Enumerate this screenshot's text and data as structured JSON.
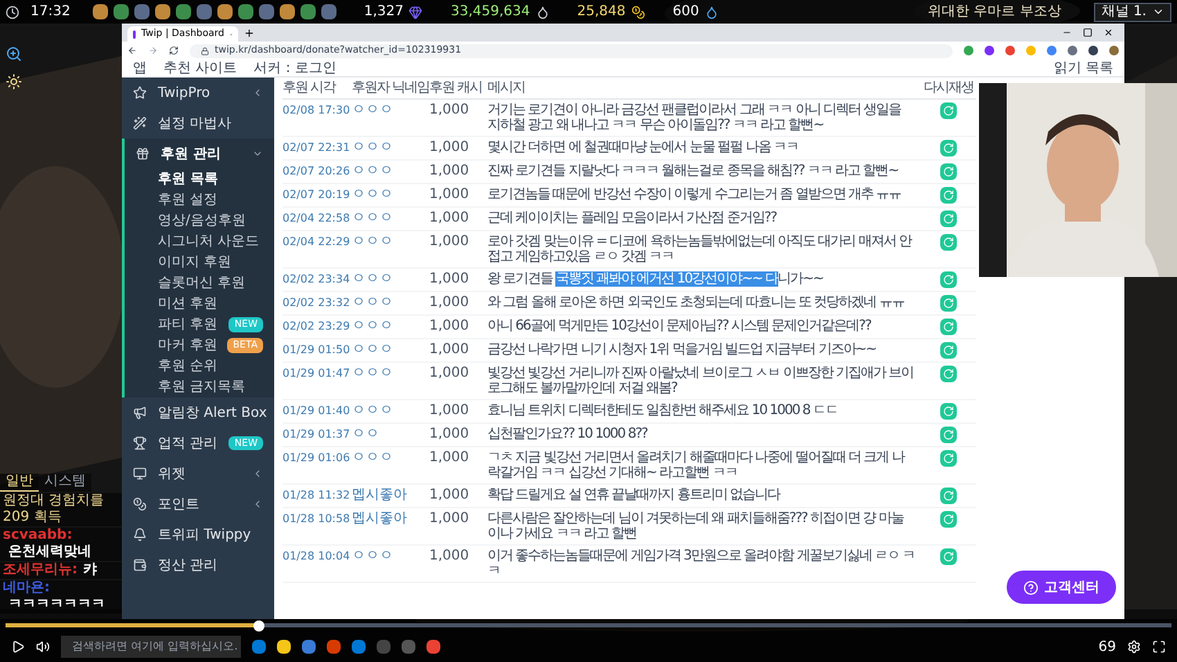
{
  "hud": {
    "time": "17:32",
    "stats": [
      "1,327",
      "33,459,634",
      "25,848",
      "600"
    ],
    "title": "위대한 우마르 부조상",
    "channel": "채널 1."
  },
  "browser": {
    "tab": {
      "title": "Twip | Dashboard",
      "selected": true
    },
    "address": "twip.kr/dashboard/donate?watcher_id=102319931",
    "bookmarks": [
      "앱",
      "추천 사이트",
      "서커 : 로그인"
    ],
    "reading_list": "읽기 목록"
  },
  "sidebar": {
    "items": [
      {
        "label": "TwipPro",
        "expanded": false
      },
      {
        "label": "설정 마법사"
      },
      {
        "label": "후원 관리",
        "expanded": true,
        "children": [
          {
            "label": "후원 목록",
            "selected": true
          },
          {
            "label": "후원 설정",
            "selected": false
          },
          {
            "label": "영상/음성후원",
            "selected": false
          },
          {
            "label": "시그니처 사운드",
            "selected": false
          },
          {
            "label": "이미지 후원",
            "selected": false
          },
          {
            "label": "슬롯머신 후원",
            "selected": false
          },
          {
            "label": "미션 후원",
            "selected": false
          },
          {
            "label": "파티 후원",
            "selected": false,
            "badge": {
              "text": "NEW",
              "kind": "new"
            }
          },
          {
            "label": "마커 후원",
            "selected": false,
            "badge": {
              "text": "BETA",
              "kind": "beta"
            }
          },
          {
            "label": "후원 순위",
            "selected": false
          },
          {
            "label": "후원 금지목록",
            "selected": false
          }
        ]
      },
      {
        "label": "알림창 Alert Box"
      },
      {
        "label": "업적 관리",
        "badge": {
          "text": "NEW",
          "kind": "new"
        }
      },
      {
        "label": "위젯",
        "expanded": false
      },
      {
        "label": "포인트",
        "expanded": false
      },
      {
        "label": "트위피 Twippy"
      },
      {
        "label": "정산 관리"
      }
    ]
  },
  "table": {
    "columns": [
      "후원 시각",
      "후원자 닉네임",
      "후원 캐시",
      "메시지",
      "다시재생"
    ],
    "rows": [
      {
        "time": "02/08 17:30",
        "nickname": "ㅇㅇㅇ",
        "cash": "1,000",
        "message": [
          {
            "text": "거기는 로기견이 아니라 금강선 팬클럽이라서 그래 ㅋㅋ 아니 디렉터 생일을 지하철 광고 왜 내나고 ㅋㅋ 무슨 아이돌임?? ㅋㅋ 라고 할뻔~",
            "selected": false
          }
        ]
      },
      {
        "time": "02/07 22:31",
        "nickname": "ㅇㅇㅇ",
        "cash": "1,000",
        "message": [
          {
            "text": "몇시간 더하면 에 철권때마냥 눈에서 눈물 펄펄 나옴 ㅋㅋ",
            "selected": false
          }
        ]
      },
      {
        "time": "02/07 20:26",
        "nickname": "ㅇㅇㅇ",
        "cash": "1,000",
        "message": [
          {
            "text": "진짜 로기견들 지랄낫다 ㅋㅋㅋ 월해는걸로 종목을 해침?? ㅋㅋ 라고 할뻔~",
            "selected": false
          }
        ]
      },
      {
        "time": "02/07 20:19",
        "nickname": "ㅇㅇㅇ",
        "cash": "1,000",
        "message": [
          {
            "text": "로기견놈들 때문에 반강선 수장이 이렇게 수그리는거 좀 열받으면 개추 ㅠㅠ",
            "selected": false
          }
        ]
      },
      {
        "time": "02/04 22:58",
        "nickname": "ㅇㅇㅇ",
        "cash": "1,000",
        "message": [
          {
            "text": "근데 케이이치는 플레임 모음이라서 가산점 준거임??",
            "selected": false
          }
        ]
      },
      {
        "time": "02/04 22:29",
        "nickname": "ㅇㅇㅇ",
        "cash": "1,000",
        "message": [
          {
            "text": "로아 갓겜 맞는이유 = 디코에 욕하는놈들밖에없는데 아직도 대가리 매져서 안접고 게임하고있음 ㄹㅇ 갓겜 ㅋㅋ",
            "selected": false
          }
        ]
      },
      {
        "time": "02/02 23:34",
        "nickname": "ㅇㅇㅇ",
        "cash": "1,000",
        "message": [
          {
            "text": "왕 로기견들 ",
            "selected": false
          },
          {
            "text": "국뽕짓 괘봐야 에거선 10강선이야~~ 다",
            "selected": true
          },
          {
            "text": "니가~~",
            "selected": false
          }
        ]
      },
      {
        "time": "02/02 23:32",
        "nickname": "ㅇㅇㅇ",
        "cash": "1,000",
        "message": [
          {
            "text": "와 그럼 올해 로아온 하면 외국인도 초청되는데 따효니는 또 컷당하겠네 ㅠㅠ",
            "selected": false
          }
        ]
      },
      {
        "time": "02/02 23:29",
        "nickname": "ㅇㅇㅇ",
        "cash": "1,000",
        "message": [
          {
            "text": "아니 66골에 먹게만든 10강선이 문제아님?? 시스템 문제인거같은데??",
            "selected": false
          }
        ]
      },
      {
        "time": "01/29 01:50",
        "nickname": "ㅇㅇㅇ",
        "cash": "1,000",
        "message": [
          {
            "text": "금강선 나락가면 니기 시청자 1위 먹을거임 빌드업 지금부터 기즈아~~",
            "selected": false
          }
        ]
      },
      {
        "time": "01/29 01:47",
        "nickname": "ㅇㅇㅇ",
        "cash": "1,000",
        "message": [
          {
            "text": "빛강선 빛강선 거리니까 진짜 아랄났네 브이로그 ㅅㅂ 이쁘장한 기집애가 브이로그해도 볼까말까인데 저걸 왜봄?",
            "selected": false
          }
        ]
      },
      {
        "time": "01/29 01:40",
        "nickname": "ㅇㅇㅇ",
        "cash": "1,000",
        "message": [
          {
            "text": "효니님 트위치 디렉터한테도 일침한번 해주세요 10 1000 8 ㄷㄷ",
            "selected": false
          }
        ]
      },
      {
        "time": "01/29 01:37",
        "nickname": "ㅇㅇ",
        "cash": "1,000",
        "message": [
          {
            "text": "십천팔인가요?? 10 1000 8??",
            "selected": false
          }
        ]
      },
      {
        "time": "01/29 01:06",
        "nickname": "ㅇㅇㅇ",
        "cash": "1,000",
        "message": [
          {
            "text": "ㄱㅊ 지금 빛강선 거리면서 올려치기 해줄때마다 나중에 떨어질때 더 크게 나락갈거임 ㅋㅋ 십강선 기대해~ 라고할뻔 ㅋㅋ",
            "selected": false
          }
        ]
      },
      {
        "time": "01/28 11:32",
        "nickname": "멥시좋아",
        "cash": "1,000",
        "message": [
          {
            "text": "확답 드릴게요 설 연휴 끝날때까지 흉트리미 없습니다",
            "selected": false
          }
        ]
      },
      {
        "time": "01/28 10:58",
        "nickname": "멥시좋아",
        "cash": "1,000",
        "message": [
          {
            "text": "다른사람은 잘안하는데 님이 겨못하는데 왜 패치들해줌??? 히접이면 걍 마눌이나 가세요 ㅋㅋ 라고 할뻔",
            "selected": false
          }
        ]
      },
      {
        "time": "01/28 10:04",
        "nickname": "ㅇㅇㅇ",
        "cash": "1,000",
        "message": [
          {
            "text": "이거 좋수하는놈들때문에 게임가격 3만원으로 올려야함 게꿀보기싫네 ㄹㅇ ㅋㅋ",
            "selected": false
          }
        ]
      }
    ]
  },
  "help_button": "고객센터",
  "chat": {
    "tabs": [
      {
        "label": "일반",
        "selected": true
      },
      {
        "label": "시스템",
        "selected": false
      }
    ],
    "messages": [
      {
        "kind": "system",
        "text": "원정대 경험치를 209 획득"
      },
      {
        "kind": "chat",
        "name": "scvaabb:",
        "color": "#e03131",
        "text": "온천세력맞네"
      },
      {
        "kind": "chat",
        "name": "조세무리뉴:",
        "color": "#e03131",
        "text": "캬"
      },
      {
        "kind": "chat",
        "name": "네마욘:",
        "color": "#3b5bdb",
        "text": "ㅋㅋㅋㅋㅋㅋㅋ"
      }
    ]
  },
  "player": {
    "level": 0.22,
    "count": "69",
    "search_placeholder": "검색하려면 여기에 입력하십시오."
  }
}
